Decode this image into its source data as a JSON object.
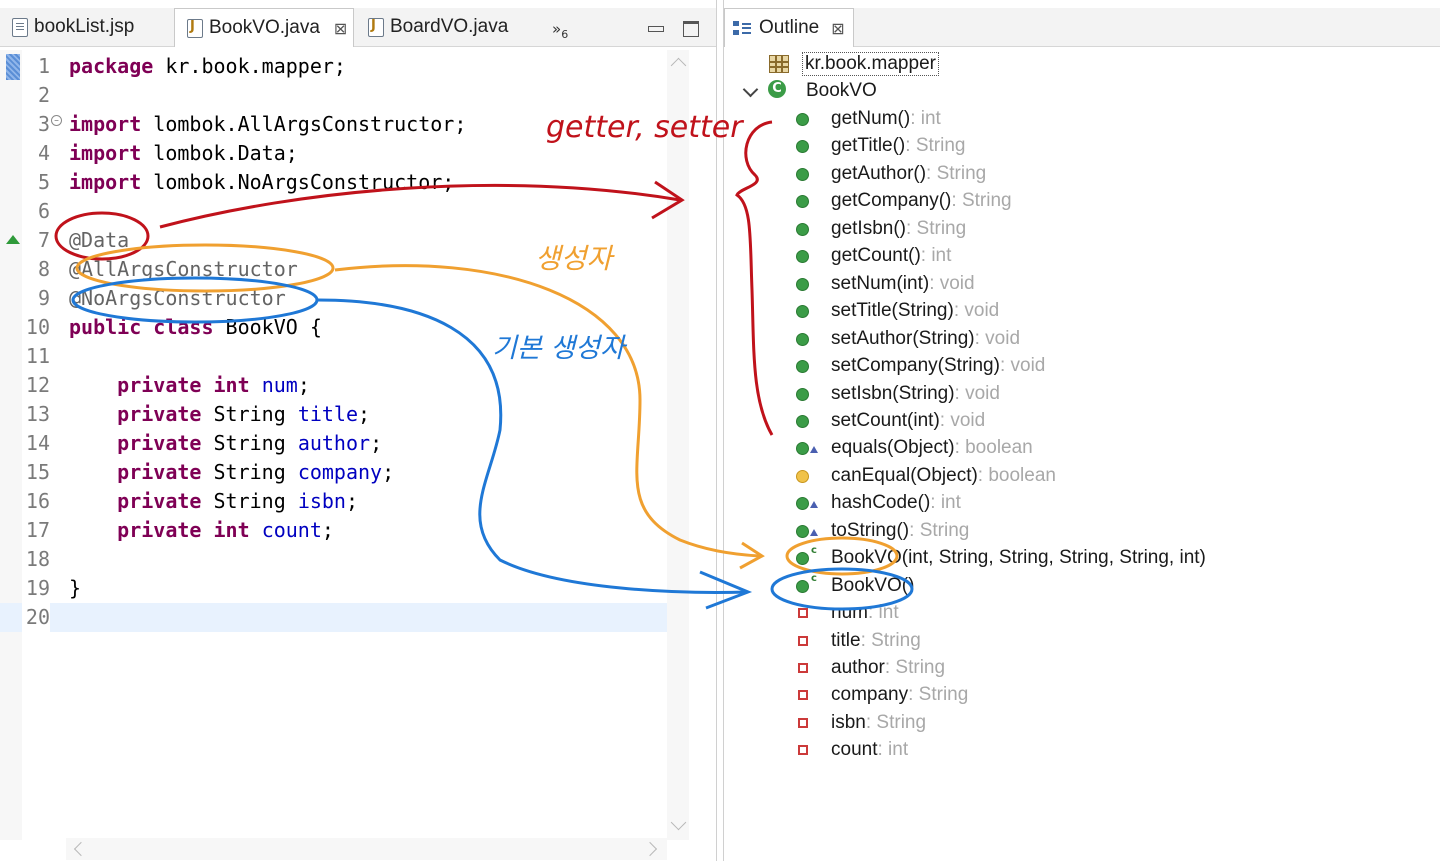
{
  "editor": {
    "tabs": [
      {
        "label": "bookList.jsp",
        "icon": "jsp-file-icon",
        "active": false
      },
      {
        "label": "BookVO.java",
        "icon": "java-file-icon",
        "active": true
      },
      {
        "label": "BoardVO.java",
        "icon": "java-file-icon",
        "active": false
      }
    ],
    "overflow_label": "»",
    "overflow_count": "6",
    "lines": [
      {
        "n": "1"
      },
      {
        "n": "2"
      },
      {
        "n": "3"
      },
      {
        "n": "4"
      },
      {
        "n": "5"
      },
      {
        "n": "6"
      },
      {
        "n": "7"
      },
      {
        "n": "8"
      },
      {
        "n": "9"
      },
      {
        "n": "10"
      },
      {
        "n": "11"
      },
      {
        "n": "12"
      },
      {
        "n": "13"
      },
      {
        "n": "14"
      },
      {
        "n": "15"
      },
      {
        "n": "16"
      },
      {
        "n": "17"
      },
      {
        "n": "18"
      },
      {
        "n": "19"
      },
      {
        "n": "20"
      }
    ],
    "code": {
      "l1_kw": "package",
      "l1_rest": " kr.book.mapper;",
      "l3_kw": "import",
      "l3_rest": " lombok.AllArgsConstructor;",
      "l4_kw": "import",
      "l4_rest": " lombok.Data;",
      "l5_kw": "import",
      "l5_rest": " lombok.NoArgsConstructor;",
      "l7_ann": "@Data",
      "l8_ann": "@AllArgsConstructor",
      "l9_ann": "@NoArgsConstructor",
      "l10_kw": "public class",
      "l10_rest": " BookVO {",
      "private": "private",
      "int": "int",
      "String": "String",
      "f_num": "num",
      "f_title": "title",
      "f_author": "author",
      "f_company": "company",
      "f_isbn": "isbn",
      "f_count": "count",
      "semi": ";",
      "l19": "}"
    }
  },
  "outline": {
    "tab_label": "Outline",
    "package": "kr.book.mapper",
    "class_name": "BookVO",
    "methods": [
      {
        "sig": "getNum()",
        "ret": " : int"
      },
      {
        "sig": "getTitle()",
        "ret": " : String"
      },
      {
        "sig": "getAuthor()",
        "ret": " : String"
      },
      {
        "sig": "getCompany()",
        "ret": " : String"
      },
      {
        "sig": "getIsbn()",
        "ret": " : String"
      },
      {
        "sig": "getCount()",
        "ret": " : int"
      },
      {
        "sig": "setNum(int)",
        "ret": " : void"
      },
      {
        "sig": "setTitle(String)",
        "ret": " : void"
      },
      {
        "sig": "setAuthor(String)",
        "ret": " : void"
      },
      {
        "sig": "setCompany(String)",
        "ret": " : void"
      },
      {
        "sig": "setIsbn(String)",
        "ret": " : void"
      },
      {
        "sig": "setCount(int)",
        "ret": " : void"
      },
      {
        "sig": "equals(Object)",
        "ret": " : boolean"
      },
      {
        "sig": "canEqual(Object)",
        "ret": " : boolean"
      },
      {
        "sig": "hashCode()",
        "ret": " : int"
      },
      {
        "sig": "toString()",
        "ret": " : String"
      },
      {
        "sig": "BookVO(int, String, String, String, String, int)",
        "ret": ""
      },
      {
        "sig": "BookVO()",
        "ret": ""
      }
    ],
    "fields": [
      {
        "sig": "num",
        "ret": " : int"
      },
      {
        "sig": "title",
        "ret": " : String"
      },
      {
        "sig": "author",
        "ret": " : String"
      },
      {
        "sig": "company",
        "ret": " : String"
      },
      {
        "sig": "isbn",
        "ret": " : String"
      },
      {
        "sig": "count",
        "ret": " : int"
      }
    ]
  },
  "annotations": {
    "getter_setter": "getter, setter",
    "constructor": "생성자",
    "default_constructor": "기본 생성자"
  },
  "colors": {
    "keyword": "#7f0055",
    "field": "#0000c0",
    "annotation": "#646464",
    "red_ink": "#c0121b",
    "orange_ink": "#f0a030",
    "blue_ink": "#1f78d6"
  }
}
